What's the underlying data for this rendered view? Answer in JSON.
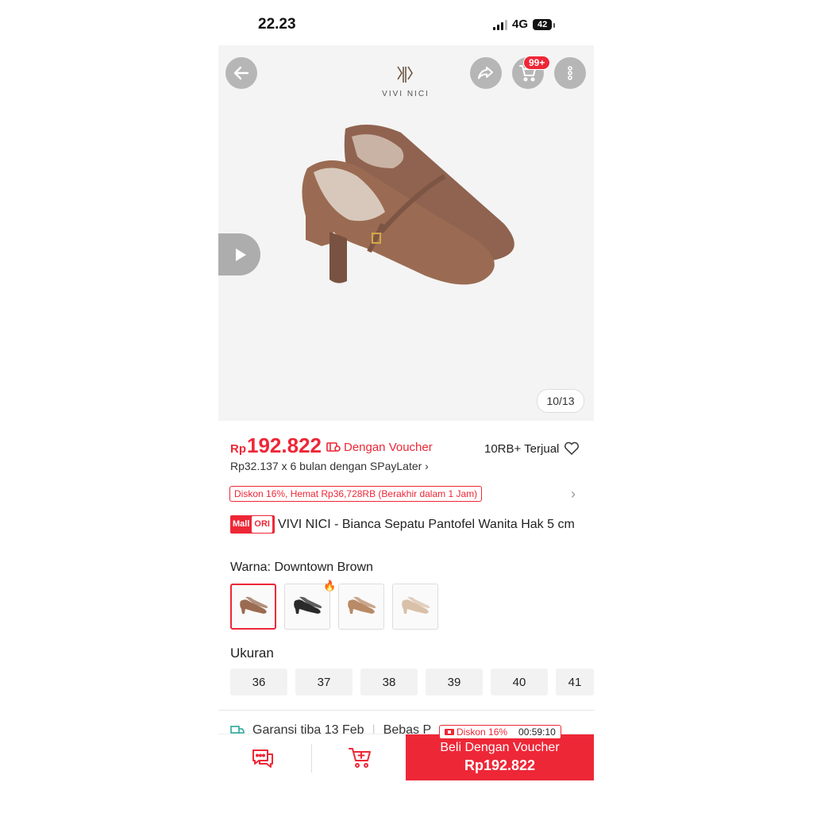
{
  "status_bar": {
    "time": "22.23",
    "network": "4G",
    "battery": "42"
  },
  "header": {
    "brand": "VIVI NICI",
    "cart_badge": "99+"
  },
  "gallery": {
    "counter": "10/13"
  },
  "pricing": {
    "currency": "Rp",
    "price": "192.822",
    "voucher_text": "Dengan Voucher",
    "sold": "10RB+ Terjual",
    "installment": "Rp32.137 x 6 bulan dengan SPayLater ›",
    "discount_text": "Diskon 16%, Hemat Rp36,728RB (Berakhir dalam 1 Jam)"
  },
  "product": {
    "badge_mall": "Mall",
    "badge_ori": "ORI",
    "title": "VIVI NICI - Bianca Sepatu Pantofel Wanita Hak 5 cm"
  },
  "variant": {
    "label": "Warna:",
    "selected": "Downtown Brown",
    "swatch_colors": [
      "#9a6b52",
      "#2a2a2a",
      "#b88a66",
      "#d9c0a8"
    ]
  },
  "sizes": {
    "label": "Ukuran",
    "options": [
      "36",
      "37",
      "38",
      "39",
      "40",
      "41"
    ]
  },
  "shipping": {
    "guarantee": "Garansi tiba 13 Feb",
    "free": "Bebas P"
  },
  "bottom": {
    "promo_discount": "Diskon 16%",
    "promo_timer": "00:59:10",
    "buy_label": "Beli Dengan Voucher",
    "buy_price": "Rp192.822"
  },
  "colors": {
    "accent": "#ee2737",
    "shoe": "#9a6b52"
  }
}
